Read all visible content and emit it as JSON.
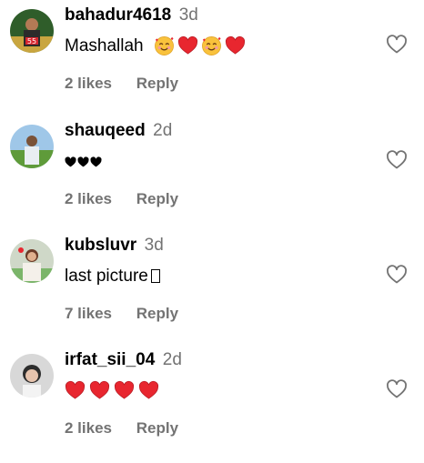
{
  "comments": [
    {
      "username": "bahadur4618",
      "time": "3d",
      "text": "Mashallah",
      "emojis": [
        "smiling-face-with-hearts",
        "red-heart",
        "smiling-face-with-hearts",
        "red-heart"
      ],
      "likes": "2 likes",
      "reply": "Reply"
    },
    {
      "username": "shauqeed",
      "time": "2d",
      "text": "",
      "emojis": [
        "black-heart",
        "black-heart",
        "black-heart"
      ],
      "likes": "2 likes",
      "reply": "Reply"
    },
    {
      "username": "kubsluvr",
      "time": "3d",
      "text": "last picture",
      "emojis": [
        "missing-glyph-box"
      ],
      "likes": "7 likes",
      "reply": "Reply"
    },
    {
      "username": "irfat_sii_04",
      "time": "2d",
      "text": "",
      "emojis": [
        "red-heart",
        "red-heart",
        "red-heart",
        "red-heart"
      ],
      "likes": "2 likes",
      "reply": "Reply"
    }
  ],
  "colors": {
    "text": "#000000",
    "muted": "#737373",
    "heart_red": "#e8262f",
    "background": "#ffffff"
  }
}
